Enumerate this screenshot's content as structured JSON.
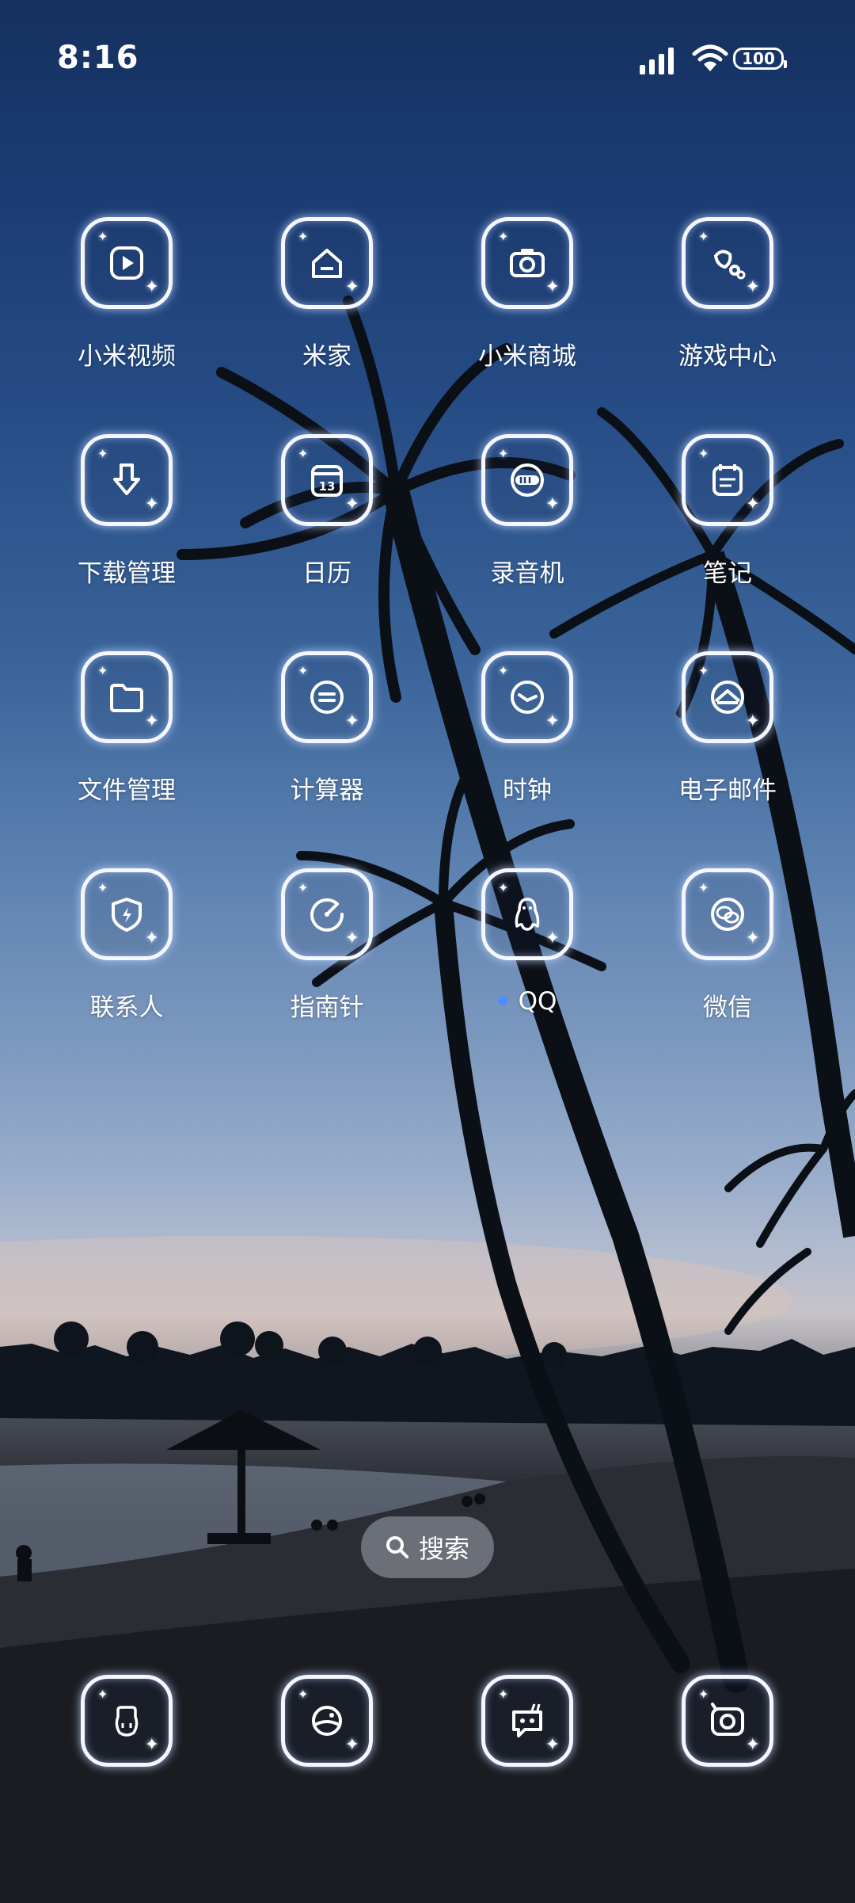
{
  "status_bar": {
    "time": "8:16",
    "battery": "100",
    "signal_icon": "signal-icon",
    "wifi_icon": "wifi-icon"
  },
  "apps": [
    {
      "label": "小米视频",
      "icon": "video-play-icon"
    },
    {
      "label": "米家",
      "icon": "home-icon"
    },
    {
      "label": "小米商城",
      "icon": "camera-shop-icon"
    },
    {
      "label": "游戏中心",
      "icon": "game-center-icon"
    },
    {
      "label": "下载管理",
      "icon": "download-icon"
    },
    {
      "label": "日历",
      "icon": "calendar-icon",
      "badge_text": "13"
    },
    {
      "label": "录音机",
      "icon": "recorder-icon"
    },
    {
      "label": "笔记",
      "icon": "notes-icon"
    },
    {
      "label": "文件管理",
      "icon": "folder-icon"
    },
    {
      "label": "计算器",
      "icon": "calculator-icon"
    },
    {
      "label": "时钟",
      "icon": "clock-icon"
    },
    {
      "label": "电子邮件",
      "icon": "mail-icon"
    },
    {
      "label": "联系人",
      "icon": "contacts-shield-icon"
    },
    {
      "label": "指南针",
      "icon": "compass-icon"
    },
    {
      "label": "QQ",
      "icon": "qq-penguin-icon",
      "new_dot": true
    },
    {
      "label": "微信",
      "icon": "wechat-icon"
    }
  ],
  "search": {
    "label": "搜索",
    "icon": "search-icon"
  },
  "dock": [
    {
      "icon": "phone-icon"
    },
    {
      "icon": "browser-icon"
    },
    {
      "icon": "messages-icon"
    },
    {
      "icon": "camera-icon"
    }
  ],
  "colors": {
    "icon_outline": "#f4f7ff",
    "glow": "#bed2ff",
    "new_dot": "#4d8dff"
  }
}
